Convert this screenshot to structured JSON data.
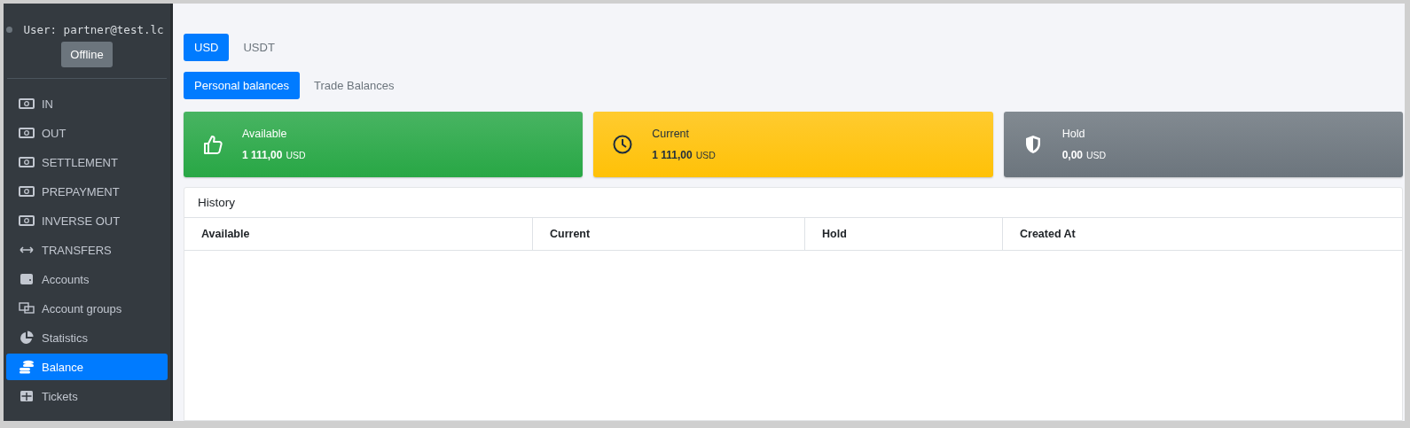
{
  "user": {
    "label": "User: partner@test.lc",
    "status": "Offline",
    "online": false
  },
  "sidebar": {
    "items": [
      {
        "label": "IN",
        "kind": "cash",
        "selected": false
      },
      {
        "label": "OUT",
        "kind": "cash",
        "selected": false
      },
      {
        "label": "SETTLEMENT",
        "kind": "cash",
        "selected": false
      },
      {
        "label": "PREPAYMENT",
        "kind": "cash",
        "selected": false
      },
      {
        "label": "INVERSE OUT",
        "kind": "cash",
        "selected": false
      },
      {
        "label": "TRANSFERS",
        "kind": "transfer",
        "selected": false
      },
      {
        "label": "Accounts",
        "kind": "wallet",
        "selected": false
      },
      {
        "label": "Account groups",
        "kind": "groups",
        "selected": false
      },
      {
        "label": "Statistics",
        "kind": "stats",
        "selected": false
      },
      {
        "label": "Balance",
        "kind": "balance",
        "selected": true
      },
      {
        "label": "Tickets",
        "kind": "tickets",
        "selected": false
      }
    ]
  },
  "currency_tabs": [
    {
      "label": "USD",
      "selected": true
    },
    {
      "label": "USDT",
      "selected": false
    }
  ],
  "balance_tabs": [
    {
      "label": "Personal balances",
      "selected": true
    },
    {
      "label": "Trade Balances",
      "selected": false
    }
  ],
  "cards": [
    {
      "kind": "success",
      "title": "Available",
      "amount": "1 111,00",
      "currency": "USD"
    },
    {
      "kind": "warning",
      "title": "Current",
      "amount": "1 111,00",
      "currency": "USD"
    },
    {
      "kind": "secondary",
      "title": "Hold",
      "amount": "0,00",
      "currency": "USD"
    }
  ],
  "history": {
    "title": "History",
    "columns": [
      "Available",
      "Current",
      "Hold",
      "Created At"
    ]
  }
}
